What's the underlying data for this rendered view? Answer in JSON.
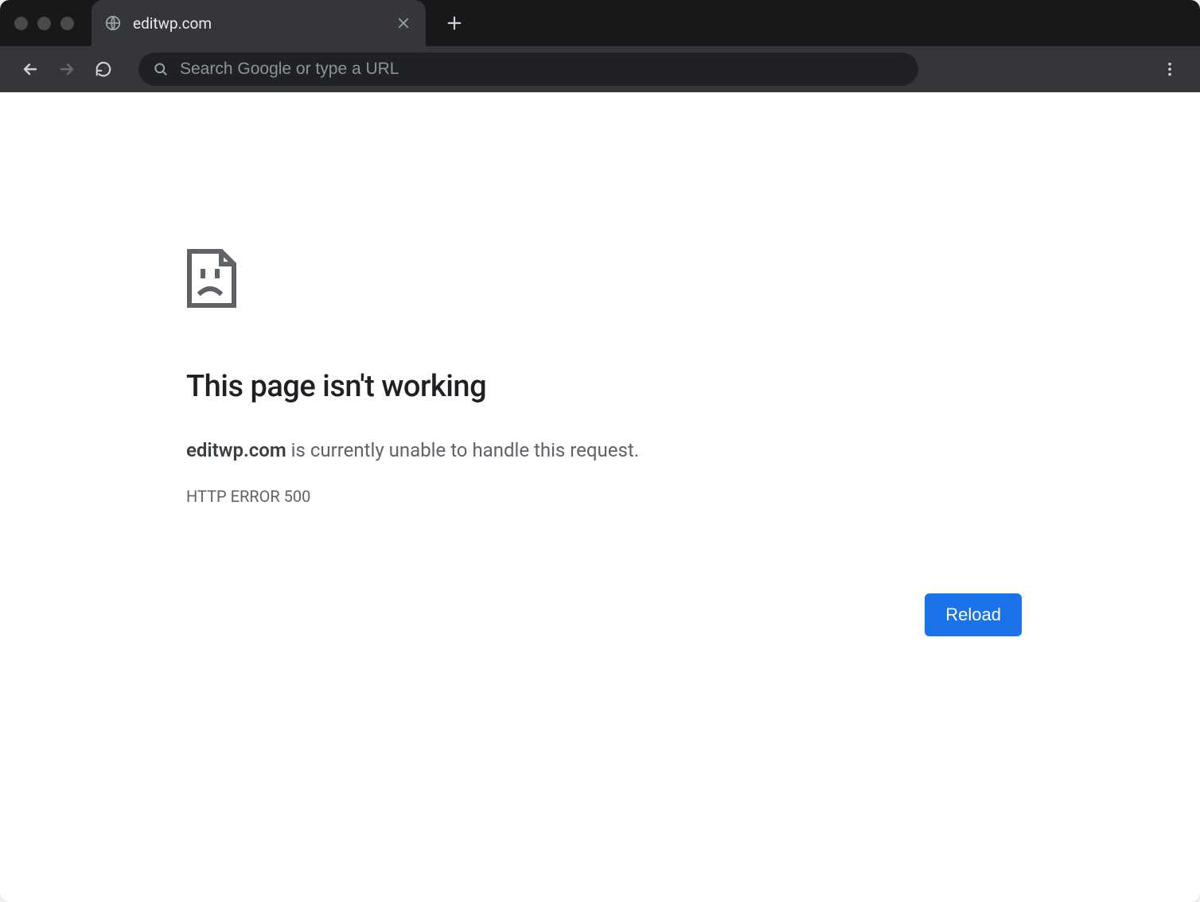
{
  "tabs": [
    {
      "title": "editwp.com"
    }
  ],
  "omnibox": {
    "placeholder": "Search Google or type a URL",
    "value": ""
  },
  "error": {
    "heading": "This page isn't working",
    "host": "editwp.com",
    "message_rest": " is currently unable to handle this request.",
    "code": "HTTP ERROR 500",
    "reload_label": "Reload"
  }
}
